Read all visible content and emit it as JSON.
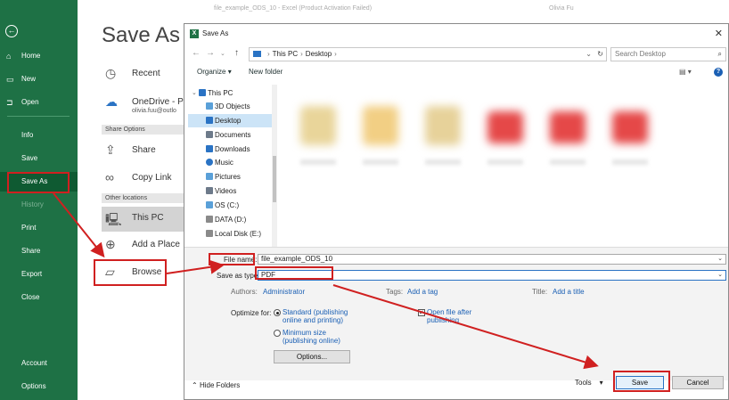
{
  "window": {
    "title": "file_example_ODS_10 - Excel (Product Activation Failed)",
    "user": "Olivia Fu"
  },
  "sidebar": {
    "back_icon": "back-arrow-icon",
    "items": [
      {
        "label": "Home",
        "icon": "home-icon"
      },
      {
        "label": "New",
        "icon": "new-doc-icon"
      },
      {
        "label": "Open",
        "icon": "folder-open-icon"
      },
      {
        "label": "Info"
      },
      {
        "label": "Save"
      },
      {
        "label": "Save As"
      },
      {
        "label": "History"
      },
      {
        "label": "Print"
      },
      {
        "label": "Share"
      },
      {
        "label": "Export"
      },
      {
        "label": "Close"
      },
      {
        "label": "Account"
      },
      {
        "label": "Options"
      }
    ],
    "active_color": "#0f5a32",
    "brand_color": "#1e7145"
  },
  "backstage": {
    "title": "Save As",
    "recent": "Recent",
    "onedrive": "OneDrive - Pe",
    "onedrive_sub": "olivia.fuu@outlo",
    "share_options_header": "Share Options",
    "share": "Share",
    "copy_link": "Copy Link",
    "other_locations_header": "Other locations",
    "this_pc": "This PC",
    "add_place": "Add a Place",
    "browse": "Browse"
  },
  "dialog": {
    "title": "Save As",
    "path": [
      "This PC",
      "Desktop"
    ],
    "search_placeholder": "Search Desktop",
    "organize": "Organize",
    "new_folder": "New folder",
    "tree": [
      {
        "label": "This PC",
        "top": true,
        "color": "#2a73c4"
      },
      {
        "label": "3D Objects",
        "color": "#5aa0d8"
      },
      {
        "label": "Desktop",
        "color": "#2a73c4",
        "selected": true
      },
      {
        "label": "Documents",
        "color": "#6d7a8a"
      },
      {
        "label": "Downloads",
        "color": "#2a73c4"
      },
      {
        "label": "Music",
        "color": "#2a73c4"
      },
      {
        "label": "Pictures",
        "color": "#5aa0d8"
      },
      {
        "label": "Videos",
        "color": "#6d7a8a"
      },
      {
        "label": "OS (C:)",
        "color": "#5aa0d8"
      },
      {
        "label": "DATA (D:)",
        "color": "#8a8a8a"
      },
      {
        "label": "Local Disk (E:)",
        "color": "#8a8a8a"
      }
    ],
    "file_name_label": "File name:",
    "file_name_value": "file_example_ODS_10",
    "save_type_label": "Save as type:",
    "save_type_value": "PDF",
    "authors_label": "Authors:",
    "authors_value": "Administrator",
    "tags_label": "Tags:",
    "tags_value": "Add a tag",
    "title_label": "Title:",
    "title_value": "Add a title",
    "optimize_label": "Optimize for:",
    "opt_standard_1": "Standard (publishing",
    "opt_standard_2": "online and printing)",
    "opt_min_1": "Minimum size",
    "opt_min_2": "(publishing online)",
    "open_after_1": "Open file after",
    "open_after_2": "publishing",
    "options_btn": "Options...",
    "hide_folders": "Hide Folders",
    "tools": "Tools",
    "save_btn": "Save",
    "cancel_btn": "Cancel"
  },
  "annotation_color": "#d02020"
}
